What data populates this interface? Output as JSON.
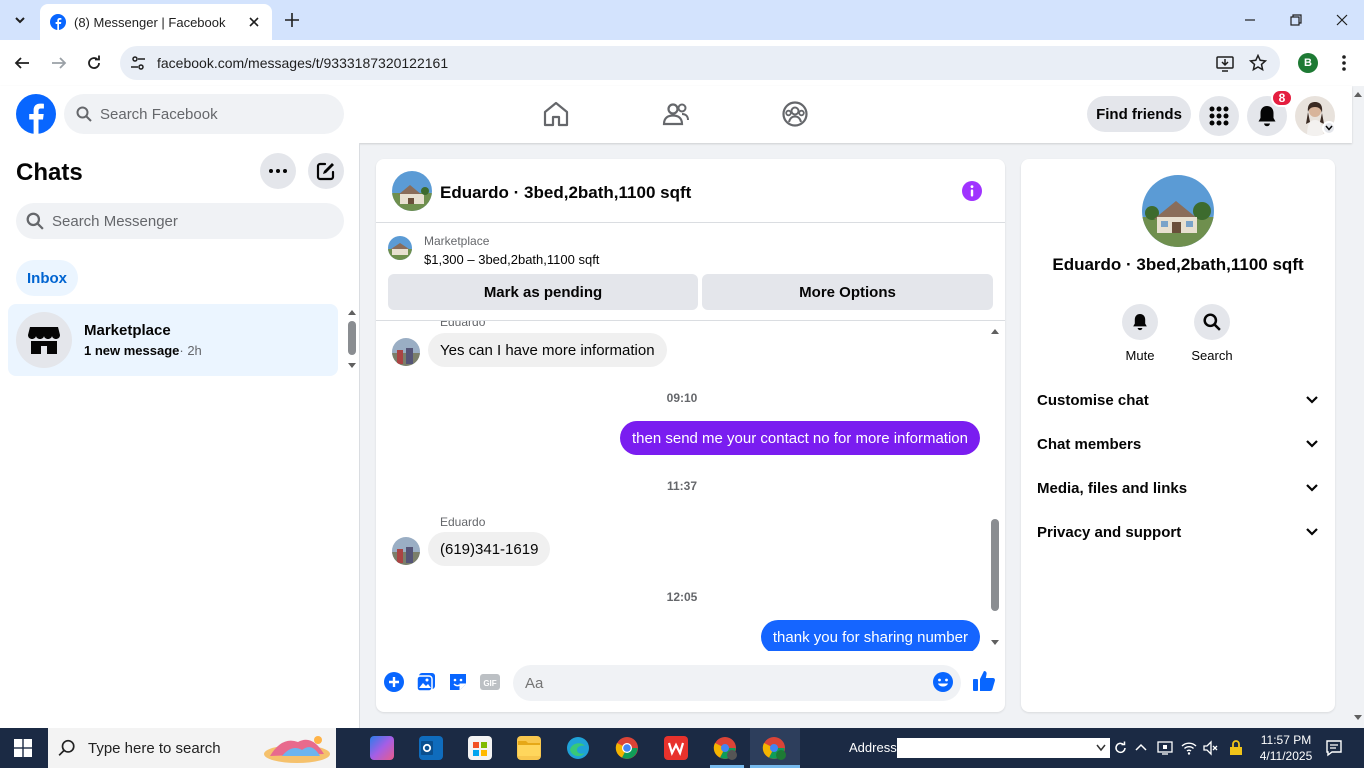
{
  "browser": {
    "tab_title": "(8) Messenger | Facebook",
    "url": "facebook.com/messages/t/9333187320122161",
    "profile_initial": "B"
  },
  "header": {
    "search_placeholder": "Search Facebook",
    "find_friends_label": "Find friends",
    "notification_count": "8"
  },
  "sidebar": {
    "title": "Chats",
    "search_placeholder": "Search Messenger",
    "filter_label": "Inbox",
    "chats": [
      {
        "name": "Marketplace",
        "preview": "1 new message",
        "time": "· 2h"
      }
    ]
  },
  "chat": {
    "title": "Eduardo · 3bed,2bath,1100 sqft",
    "marketplace_label": "Marketplace",
    "listing": "$1,300 – 3bed,2bath,1100 sqft",
    "mark_pending_label": "Mark as pending",
    "more_options_label": "More Options",
    "messages": [
      {
        "type": "in",
        "sender": "Eduardo",
        "text": "Yes can I have more information"
      },
      {
        "type": "time",
        "text": "09:10"
      },
      {
        "type": "out",
        "text": "then send me your contact no for more information"
      },
      {
        "type": "time",
        "text": "11:37"
      },
      {
        "type": "in",
        "sender": "Eduardo",
        "text": "(619)341-1619"
      },
      {
        "type": "time",
        "text": "12:05"
      },
      {
        "type": "out",
        "text": "thank you for sharing number"
      }
    ],
    "composer_placeholder": "Aa"
  },
  "info_panel": {
    "name": "Eduardo · 3bed,2bath,1100 sqft",
    "actions": [
      {
        "label": "Mute",
        "icon": "bell-icon"
      },
      {
        "label": "Search",
        "icon": "search-icon"
      }
    ],
    "sections": [
      "Customise chat",
      "Chat members",
      "Media, files and links",
      "Privacy and support"
    ]
  },
  "taskbar": {
    "search_placeholder": "Type here to search",
    "address_label": "Address",
    "time": "11:57 PM",
    "date": "4/11/2025"
  },
  "colors": {
    "fb_blue": "#0866ff",
    "outgoing_purple": "#7a1df0",
    "outgoing_blue": "#1565ff",
    "badge_red": "#e41e3f"
  }
}
